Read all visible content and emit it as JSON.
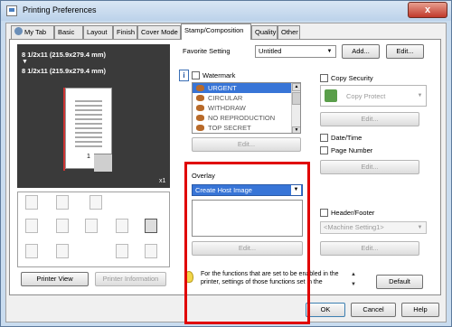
{
  "window": {
    "title": "Printing Preferences",
    "close_label": "x"
  },
  "tabs": [
    {
      "label": "My Tab"
    },
    {
      "label": "Basic"
    },
    {
      "label": "Layout"
    },
    {
      "label": "Finish"
    },
    {
      "label": "Cover Mode"
    },
    {
      "label": "Stamp/Composition",
      "active": true
    },
    {
      "label": "Quality"
    },
    {
      "label": "Other"
    }
  ],
  "preview": {
    "paper_line1": "8 1/2x11 (215.9x279.4 mm)",
    "arrow": "▼",
    "paper_line2": "8 1/2x11 (215.9x279.4 mm)",
    "copies": "x1",
    "page_number": "1"
  },
  "left_buttons": {
    "printer_view": "Printer View",
    "printer_information": "Printer Information"
  },
  "favorite": {
    "label": "Favorite Setting",
    "value": "Untitled",
    "add": "Add...",
    "edit": "Edit..."
  },
  "watermark": {
    "label": "Watermark",
    "items": [
      "URGENT",
      "CIRCULAR",
      "WITHDRAW",
      "NO REPRODUCTION",
      "TOP SECRET"
    ],
    "selected_index": 0,
    "edit": "Edit..."
  },
  "copy_security": {
    "label": "Copy Security",
    "value": "Copy Protect",
    "edit": "Edit..."
  },
  "date_time": {
    "label": "Date/Time"
  },
  "page_number": {
    "label": "Page Number",
    "edit": "Edit..."
  },
  "overlay": {
    "label": "Overlay",
    "value": "Create Host Image",
    "edit": "Edit..."
  },
  "header_footer": {
    "label": "Header/Footer",
    "value": "<Machine Setting1>",
    "edit": "Edit..."
  },
  "info": {
    "text": "For the functions that are set to be enabled in the printer, settings of those functions set in the"
  },
  "default_button": "Default",
  "footer": {
    "ok": "OK",
    "cancel": "Cancel",
    "help": "Help"
  },
  "colors": {
    "selection": "#3875d7",
    "highlight": "#e00000"
  }
}
